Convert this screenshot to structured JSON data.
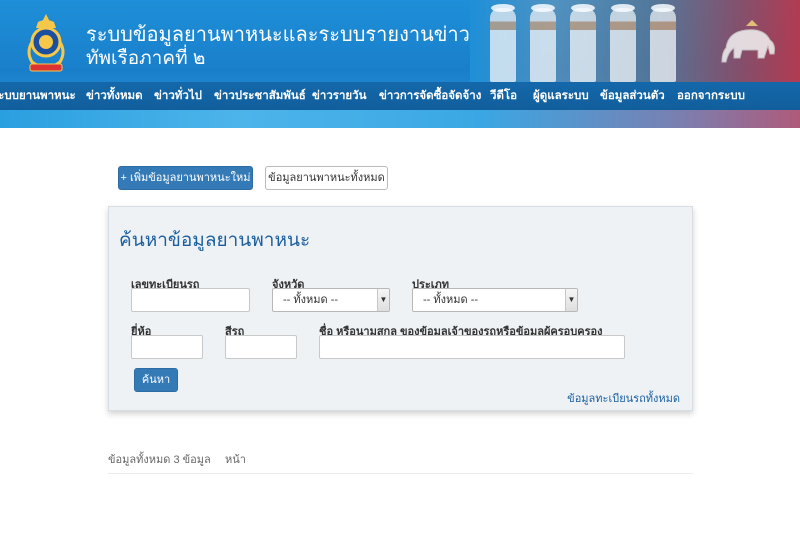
{
  "header": {
    "title_main": "ระบบข้อมูลยานพาหนะและระบบรายงานข่าว",
    "title_sub": "ทัพเรือภาคที่ ๒"
  },
  "nav": {
    "items": [
      "ระบบยานพาหนะ",
      "ข่าวทั้งหมด",
      "ข่าวทั่วไป",
      "ข่าวประชาสัมพันธ์",
      "ข่าวรายวัน",
      "ข่าวการจัดซื้อจัดจ้าง",
      "วีดีโอ",
      "ผู้ดูแลระบบ",
      "ข้อมูลส่วนตัว",
      "ออกจากระบบ"
    ]
  },
  "actions": {
    "add_label": "+ เพิ่มข้อมูลยานพาหนะใหม่",
    "all_label": "ข้อมูลยานพาหนะทั้งหมด"
  },
  "search": {
    "title": "ค้นหาข้อมูลยานพาหนะ",
    "plate_label": "เลขทะเบียนรถ",
    "plate_value": "",
    "province_label": "จังหวัด",
    "province_value": "-- ทั้งหมด --",
    "type_label": "ประเภท",
    "type_value": "-- ทั้งหมด --",
    "brand_label": "ยี่ห้อ",
    "brand_value": "",
    "color_label": "สีรถ",
    "color_value": "",
    "owner_label": "ชื่อ หรือนามสกุล ของข้อมูลเจ้าของรถหรือข้อมูลผู้ครอบครอง",
    "owner_value": "",
    "search_button": "ค้นหา",
    "all_link": "ข้อมูลทะเบียนรถทั้งหมด"
  },
  "results": {
    "summary": "ข้อมูลทั้งหมด 3 ข้อมูล",
    "page_label": "หน้า"
  },
  "colors": {
    "primary": "#337ab7",
    "header_blue": "#1a7fcb",
    "nav_blue": "#115e9c",
    "panel_bg": "#eef2f5",
    "title_blue": "#1b5f9e"
  }
}
